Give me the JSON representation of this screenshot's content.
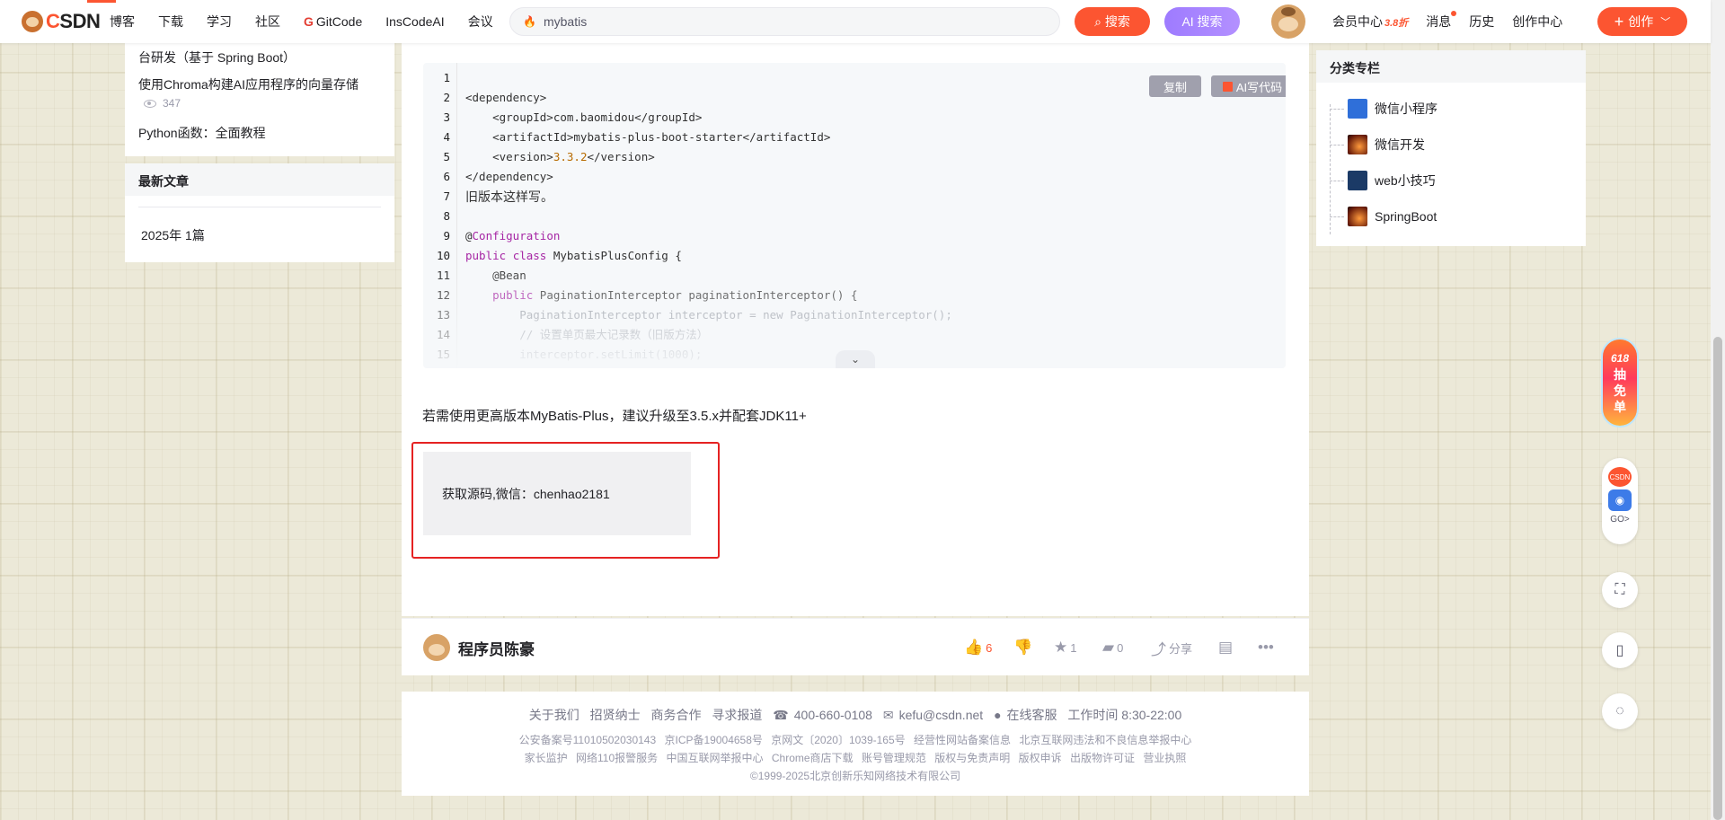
{
  "header": {
    "logo_text": "CSDN",
    "nav": [
      "博客",
      "下载",
      "学习",
      "社区",
      "GitCode",
      "InsCodeAI",
      "会议"
    ],
    "search_value": "mybatis",
    "search_button": "搜索",
    "ai_search_button": "AI 搜索",
    "right_nav": [
      "会员中心",
      "消息",
      "历史",
      "创作中心"
    ],
    "member_badge": "3.8折",
    "create_button": "创作"
  },
  "left": {
    "links": [
      "台研发（基于 Spring Boot）",
      "使用Chroma构建AI应用程序的向量存储",
      "Python函数：全面教程"
    ],
    "views": "347",
    "latest_title": "最新文章",
    "year_count": "2025年  1篇"
  },
  "code": {
    "copy_button": "复制",
    "ai_code_button": "AI写代码",
    "lines": [
      {
        "n": "1",
        "t": ""
      },
      {
        "n": "2",
        "t": "<dependency>"
      },
      {
        "n": "3",
        "t": "    <groupId>com.baomidou</groupId>"
      },
      {
        "n": "4",
        "t": "    <artifactId>mybatis-plus-boot-starter</artifactId>"
      },
      {
        "n": "5",
        "t": "    <version>3.3.2</version>"
      },
      {
        "n": "6",
        "t": "</dependency>"
      },
      {
        "n": "7",
        "t": "旧版本这样写。"
      },
      {
        "n": "8",
        "t": ""
      },
      {
        "n": "9",
        "t": "@Configuration"
      },
      {
        "n": "10",
        "t": "public class MybatisPlusConfig {"
      },
      {
        "n": "11",
        "t": "    @Bean"
      },
      {
        "n": "12",
        "t": "    public PaginationInterceptor paginationInterceptor() {"
      },
      {
        "n": "13",
        "t": "        PaginationInterceptor interceptor = new PaginationInterceptor();"
      },
      {
        "n": "14",
        "t": "        // 设置单页最大记录数（旧版方法）"
      },
      {
        "n": "15",
        "t": "        interceptor.setLimit(1000);"
      }
    ]
  },
  "article": {
    "paragraph": "若需使用更高版本MyBatis-Plus，建议升级至3.5.x并配套JDK11+",
    "source_box": "获取源码,微信：chenhao2181"
  },
  "toolbar": {
    "author": "程序员陈豪",
    "likes": "6",
    "favorites": "1",
    "comments": "0",
    "share": "分享"
  },
  "footer": {
    "links": [
      "关于我们",
      "招贤纳士",
      "商务合作",
      "寻求报道",
      "400-660-0108",
      "kefu@csdn.net",
      "在线客服",
      "工作时间 8:30-22:00"
    ],
    "line2": [
      "公安备案号11010502030143",
      "京ICP备19004658号",
      "京网文〔2020〕1039-165号",
      "经营性网站备案信息",
      "北京互联网违法和不良信息举报中心"
    ],
    "line3": [
      "家长监护",
      "网络110报警服务",
      "中国互联网举报中心",
      "Chrome商店下载",
      "账号管理规范",
      "版权与免责声明",
      "版权申诉",
      "出版物许可证",
      "营业执照"
    ],
    "copyright": "©1999-2025北京创新乐知网络技术有限公司"
  },
  "right": {
    "title": "分类专栏",
    "columns": [
      {
        "name": "微信小程序",
        "color": "#2f6fd9"
      },
      {
        "name": "微信开发",
        "color": "#d9531e"
      },
      {
        "name": "web小技巧",
        "color": "#1b3a66"
      },
      {
        "name": "SpringBoot",
        "color": "#d9531e"
      }
    ]
  },
  "floating": {
    "promo": "618抽免单",
    "promo_top": "618",
    "promo_chars": [
      "抽",
      "免",
      "单"
    ],
    "csdn_badge": "CSDN",
    "go_label": "GO>"
  },
  "colors": {
    "brand": "#fc5531",
    "ai": "#a47eff",
    "box_border": "#e52222"
  }
}
